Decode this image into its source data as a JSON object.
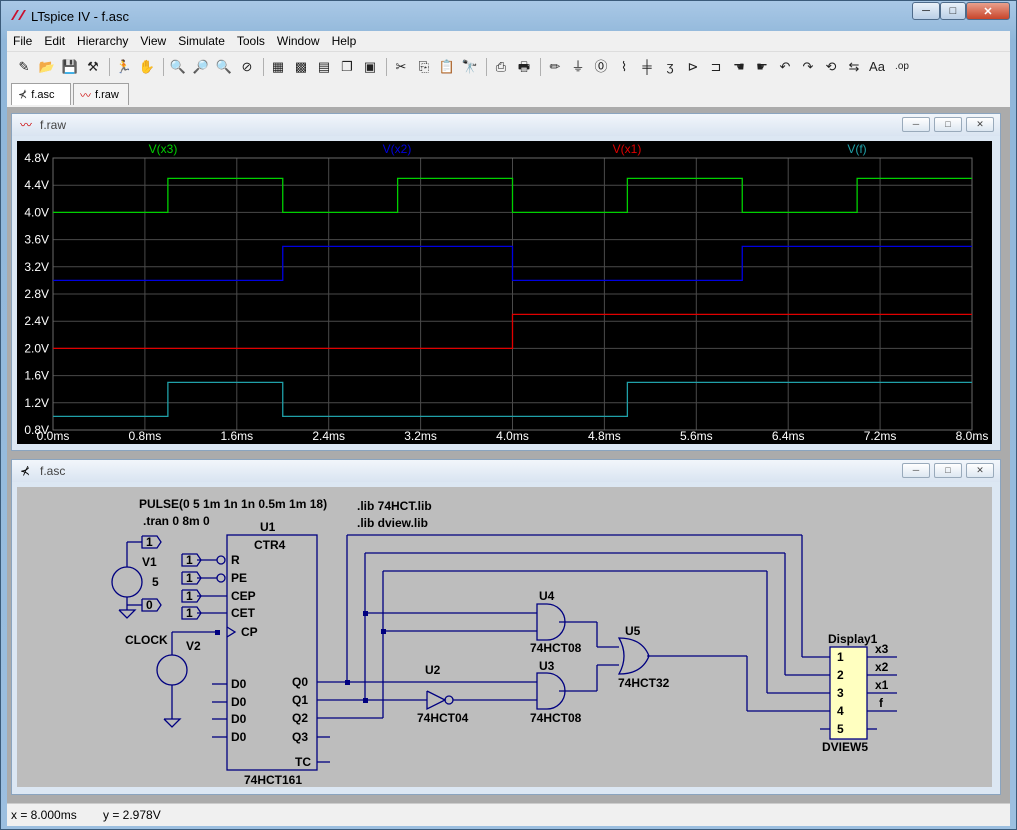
{
  "app": {
    "title": "LTspice IV - f.asc",
    "caption": {
      "minimize": "─",
      "maximize": "□",
      "close": "✕"
    }
  },
  "menu": [
    "File",
    "Edit",
    "Hierarchy",
    "View",
    "Simulate",
    "Tools",
    "Window",
    "Help"
  ],
  "toolbar": {
    "icons": [
      "open-schematic-icon",
      "open-folder-icon",
      "save-icon",
      "hammer-icon",
      "run-icon",
      "pan-hand-icon",
      "zoom-in-icon",
      "zoom-area-icon",
      "zoom-out-icon",
      "zoom-cancel-icon",
      "autorange-icon",
      "grid-icon",
      "tile-horizontal-icon",
      "cascade-icon",
      "tile-icon",
      "cut-icon",
      "copy-icon",
      "paste-icon",
      "find-icon",
      "print-setup-icon",
      "print-icon",
      "draw-wire-icon",
      "ground-icon",
      "label-net-icon",
      "resistor-icon",
      "capacitor-icon",
      "inductor-icon",
      "diode-icon",
      "component-icon",
      "move-icon",
      "drag-icon",
      "undo-icon",
      "redo-icon",
      "rotate-icon",
      "mirror-icon",
      "text-icon",
      "spice-directive-icon"
    ],
    "glyphs": [
      "✎",
      "📂",
      "💾",
      "⚒",
      "🏃",
      "✋",
      "🔍",
      "🔎",
      "🔍",
      "⊘",
      "▦",
      "▩",
      "▤",
      "❐",
      "▣",
      "✂",
      "⎘",
      "📋",
      "🔭",
      "⎙",
      "🖶",
      "✏",
      "⏚",
      "⓪",
      "⌇",
      "╪",
      "ʒ",
      "⊳",
      "⊐",
      "☚",
      "☛",
      "↶",
      "↷",
      "⟲",
      "⇆",
      "Aa",
      ".op"
    ],
    "text_label": "Aa",
    "op_label": ".op"
  },
  "tabs": [
    {
      "label": "f.asc",
      "active": true,
      "icon": "schematic-icon"
    },
    {
      "label": "f.raw",
      "active": false,
      "icon": "waveform-icon"
    }
  ],
  "waveform_window": {
    "title": "f.raw"
  },
  "schematic_window": {
    "title": "f.asc"
  },
  "chart_data": {
    "type": "line",
    "title": "",
    "xlabel": "",
    "ylabel": "",
    "xlim": [
      0,
      8.0
    ],
    "ylim": [
      0.8,
      4.8
    ],
    "x_ticks": [
      "0.0ms",
      "0.8ms",
      "1.6ms",
      "2.4ms",
      "3.2ms",
      "4.0ms",
      "4.8ms",
      "5.6ms",
      "6.4ms",
      "7.2ms",
      "8.0ms"
    ],
    "y_ticks": [
      "4.8V",
      "4.4V",
      "4.0V",
      "3.6V",
      "3.2V",
      "2.8V",
      "2.4V",
      "2.0V",
      "1.6V",
      "1.2V",
      "0.8V"
    ],
    "grid": true,
    "legend": "top",
    "series": [
      {
        "name": "V(x3)",
        "color": "#00d000",
        "x": [
          0,
          1,
          1,
          2,
          2,
          3,
          3,
          4,
          4,
          5,
          5,
          6,
          6,
          7,
          7,
          8
        ],
        "y": [
          4.0,
          4.0,
          4.5,
          4.5,
          4.0,
          4.0,
          4.5,
          4.5,
          4.0,
          4.0,
          4.5,
          4.5,
          4.0,
          4.0,
          4.5,
          4.5
        ]
      },
      {
        "name": "V(x2)",
        "color": "#0000e0",
        "x": [
          0,
          2,
          2,
          4,
          4,
          6,
          6,
          8
        ],
        "y": [
          3.0,
          3.0,
          3.5,
          3.5,
          3.0,
          3.0,
          3.5,
          3.5
        ]
      },
      {
        "name": "V(x1)",
        "color": "#e00000",
        "x": [
          0,
          4,
          4,
          8
        ],
        "y": [
          2.0,
          2.0,
          2.5,
          2.5
        ]
      },
      {
        "name": "V(f)",
        "color": "#20a0a8",
        "x": [
          0,
          1,
          1,
          2,
          2,
          5,
          5,
          8
        ],
        "y": [
          1.0,
          1.0,
          1.5,
          1.5,
          1.0,
          1.0,
          1.5,
          1.5
        ]
      }
    ]
  },
  "schematic": {
    "directives": {
      "pulse": "PULSE(0 5 1m 1n 1n 0.5m 1m 18)",
      "tran": ".tran 0 8m 0",
      "lib1": ".lib 74HCT.lib",
      "lib2": ".lib dview.lib"
    },
    "v1": {
      "name": "V1",
      "value": "5"
    },
    "v2": {
      "name": "V2"
    },
    "clock_label": "CLOCK",
    "const_one": "1",
    "const_zero": "0",
    "u1": {
      "name": "U1",
      "type": "CTR4",
      "part": "74HCT161",
      "pins_left": [
        "R",
        "PE",
        "CEP",
        "CET",
        "CP",
        "D0",
        "D0",
        "D0",
        "D0"
      ],
      "pins_right": [
        "Q0",
        "Q1",
        "Q2",
        "Q3",
        "TC"
      ]
    },
    "u2": {
      "name": "U2",
      "part": "74HCT04"
    },
    "u3": {
      "name": "U3",
      "part": "74HCT08"
    },
    "u4": {
      "name": "U4",
      "part": "74HCT08"
    },
    "u5": {
      "name": "U5",
      "part": "74HCT32"
    },
    "display": {
      "name": "Display1",
      "part": "DVIEW5",
      "pins": [
        "1",
        "2",
        "3",
        "4",
        "5"
      ],
      "nets": [
        "x3",
        "x2",
        "x1",
        "f"
      ]
    }
  },
  "status": {
    "x": "x = 8.000ms",
    "y": "y = 2.978V"
  }
}
